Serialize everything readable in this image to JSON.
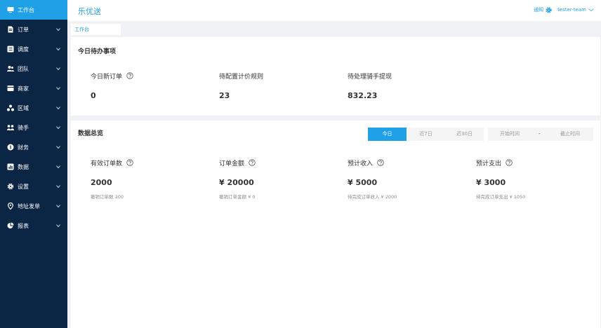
{
  "sidebar": {
    "items": [
      {
        "label": "工作台",
        "icon": "monitor-icon",
        "active": true
      },
      {
        "label": "订单",
        "icon": "document-icon"
      },
      {
        "label": "调度",
        "icon": "list-icon"
      },
      {
        "label": "团队",
        "icon": "team-icon"
      },
      {
        "label": "商家",
        "icon": "store-icon"
      },
      {
        "label": "区域",
        "icon": "region-icon"
      },
      {
        "label": "骑手",
        "icon": "rider-icon"
      },
      {
        "label": "财务",
        "icon": "finance-icon"
      },
      {
        "label": "数据",
        "icon": "data-icon"
      },
      {
        "label": "设置",
        "icon": "gear-icon"
      },
      {
        "label": "地址发单",
        "icon": "location-icon"
      },
      {
        "label": "报表",
        "icon": "pie-chart-icon"
      }
    ]
  },
  "header": {
    "brand": "乐优送",
    "notify": "通知",
    "user": "tester-team"
  },
  "tabs": [
    {
      "label": "工作台"
    }
  ],
  "todo": {
    "title": "今日待办事项",
    "stats": [
      {
        "label": "今日新订单",
        "value": "0",
        "help": true
      },
      {
        "label": "待配置计价规则",
        "value": "23"
      },
      {
        "label": "待处理骑手提现",
        "value": "832.23"
      }
    ]
  },
  "overview": {
    "title": "数据总览",
    "filters": [
      "今日",
      "近7日",
      "近30日"
    ],
    "date_start": "开始时间",
    "date_sep": "-",
    "date_end": "截止时间",
    "stats": [
      {
        "label": "有效订单数",
        "value": "2000",
        "sub": "撤销订单数 200"
      },
      {
        "label": "订单金额",
        "value": "¥ 20000",
        "sub": "撤销订单金额 ¥ 0"
      },
      {
        "label": "预计收入",
        "value": "¥ 5000",
        "sub": "待完成订单收入 ¥ 2000"
      },
      {
        "label": "预计支出",
        "value": "¥ 3000",
        "sub": "待完成订单支出 ¥ 1050"
      }
    ]
  },
  "colors": {
    "sidebar_bg": "#0b2545",
    "accent": "#20a0e6",
    "page_bg": "#f0f2f5"
  }
}
